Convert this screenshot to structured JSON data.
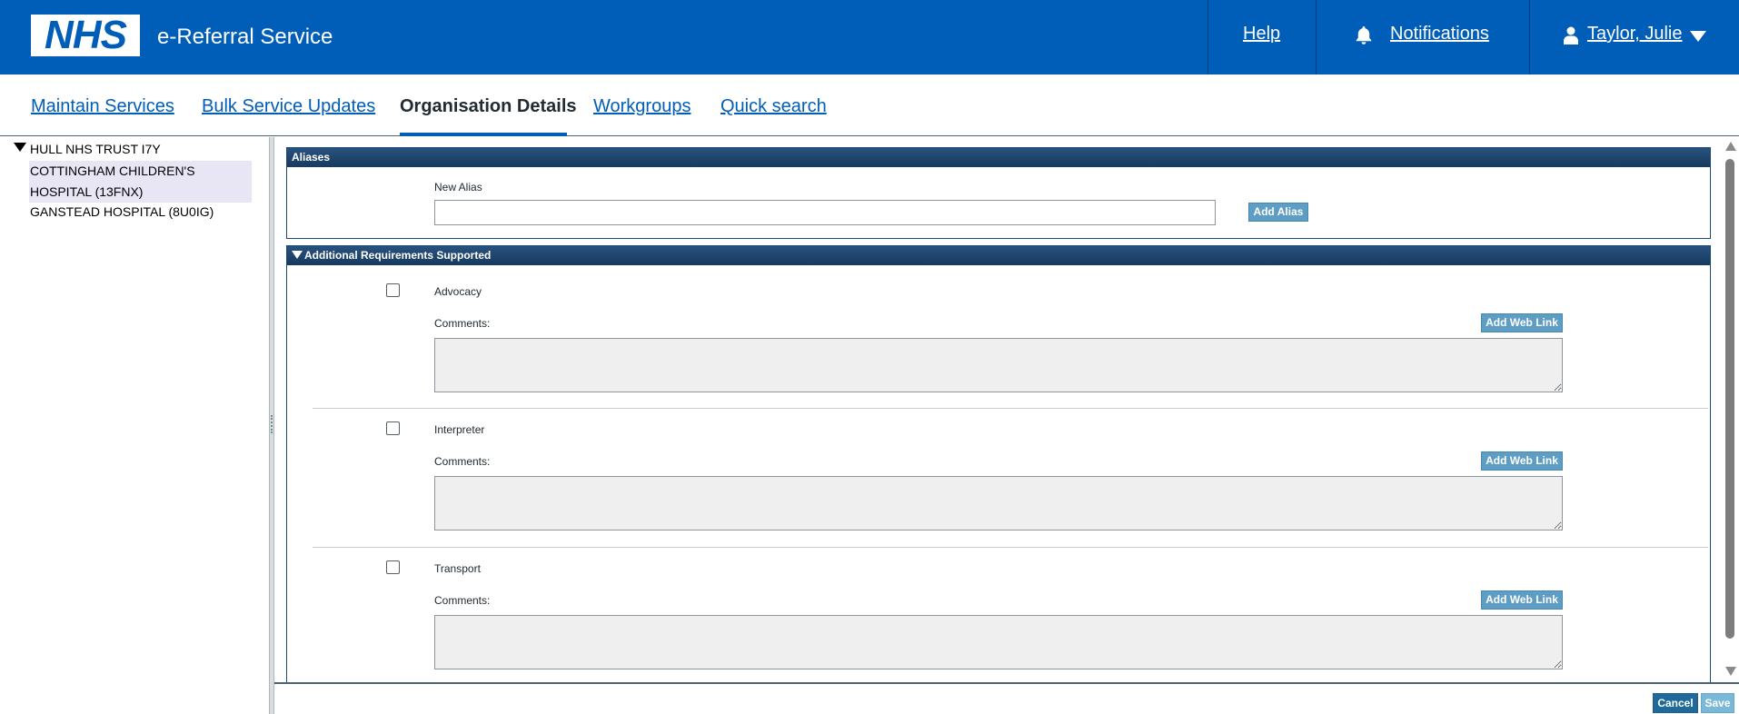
{
  "header": {
    "logo_text": "NHS",
    "service_name": "e-Referral Service",
    "help_label": "Help",
    "notifications_label": "Notifications",
    "user_name": "Taylor, Julie",
    "icons": {
      "bell": "bell-icon",
      "user": "user-icon",
      "caret": "caret-down-icon"
    }
  },
  "tabs": [
    {
      "label": "Maintain Services",
      "active": false
    },
    {
      "label": "Bulk Service Updates",
      "active": false
    },
    {
      "label": "Organisation Details",
      "active": true
    },
    {
      "label": "Workgroups",
      "active": false
    },
    {
      "label": "Quick search",
      "active": false
    }
  ],
  "tree": {
    "root": "HULL NHS TRUST I7Y",
    "items": [
      {
        "label": "COTTINGHAM CHILDREN'S HOSPITAL (13FNX)",
        "selected": true
      },
      {
        "label": "GANSTEAD HOSPITAL (8U0IG)",
        "selected": false
      }
    ]
  },
  "aliases": {
    "title": "Aliases",
    "new_alias_label": "New Alias",
    "new_alias_value": "",
    "add_alias_label": "Add Alias"
  },
  "requirements": {
    "title": "Additional Requirements Supported",
    "comments_label": "Comments:",
    "add_link_label": "Add Web Link",
    "items": [
      {
        "label": "Advocacy",
        "checked": false,
        "comments": ""
      },
      {
        "label": "Interpreter",
        "checked": false,
        "comments": ""
      },
      {
        "label": "Transport",
        "checked": false,
        "comments": ""
      }
    ]
  },
  "footer": {
    "cancel_label": "Cancel",
    "save_label": "Save"
  },
  "colors": {
    "nhs_blue": "#005eb8",
    "section_header": "#1c4a78",
    "small_button": "#5e9dc4",
    "cancel_button": "#1f6a9a",
    "save_button": "#7ab8d8"
  }
}
